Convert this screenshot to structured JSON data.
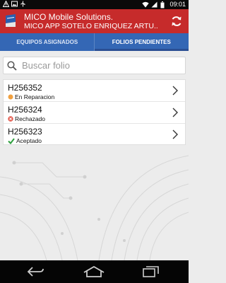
{
  "status_bar": {
    "time": "09:01"
  },
  "header": {
    "title": "MICO Mobile Solutions.",
    "subtitle": "MICO APP SOTELO ENRIQUEZ ARTU..."
  },
  "tabs": [
    {
      "label": "EQUIPOS ASIGNADOS",
      "active": false
    },
    {
      "label": "FOLIOS PENDIENTES",
      "active": true
    }
  ],
  "search": {
    "placeholder": "Buscar folio"
  },
  "folios": [
    {
      "id": "H256352",
      "status": "En Reparacion",
      "status_icon": "orange-dot-icon",
      "status_color": "#f0a040"
    },
    {
      "id": "H256324",
      "status": "Rechazado",
      "status_icon": "red-x-icon",
      "status_color": "#e35a4d"
    },
    {
      "id": "H256323",
      "status": "Aceptado",
      "status_icon": "green-check-icon",
      "status_color": "#2e9e3e"
    }
  ],
  "colors": {
    "header": "#c62b2b",
    "tabs": "#3467b5",
    "background": "#ececec"
  }
}
